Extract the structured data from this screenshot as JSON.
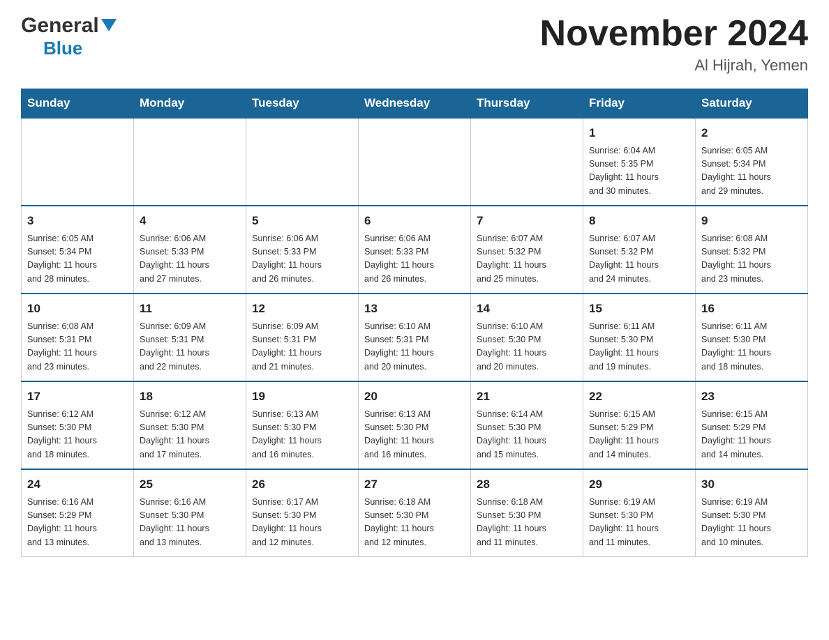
{
  "header": {
    "logo_general": "General",
    "logo_blue": "Blue",
    "month_title": "November 2024",
    "location": "Al Hijrah, Yemen"
  },
  "weekdays": [
    "Sunday",
    "Monday",
    "Tuesday",
    "Wednesday",
    "Thursday",
    "Friday",
    "Saturday"
  ],
  "weeks": [
    [
      {
        "day": "",
        "info": ""
      },
      {
        "day": "",
        "info": ""
      },
      {
        "day": "",
        "info": ""
      },
      {
        "day": "",
        "info": ""
      },
      {
        "day": "",
        "info": ""
      },
      {
        "day": "1",
        "info": "Sunrise: 6:04 AM\nSunset: 5:35 PM\nDaylight: 11 hours\nand 30 minutes."
      },
      {
        "day": "2",
        "info": "Sunrise: 6:05 AM\nSunset: 5:34 PM\nDaylight: 11 hours\nand 29 minutes."
      }
    ],
    [
      {
        "day": "3",
        "info": "Sunrise: 6:05 AM\nSunset: 5:34 PM\nDaylight: 11 hours\nand 28 minutes."
      },
      {
        "day": "4",
        "info": "Sunrise: 6:06 AM\nSunset: 5:33 PM\nDaylight: 11 hours\nand 27 minutes."
      },
      {
        "day": "5",
        "info": "Sunrise: 6:06 AM\nSunset: 5:33 PM\nDaylight: 11 hours\nand 26 minutes."
      },
      {
        "day": "6",
        "info": "Sunrise: 6:06 AM\nSunset: 5:33 PM\nDaylight: 11 hours\nand 26 minutes."
      },
      {
        "day": "7",
        "info": "Sunrise: 6:07 AM\nSunset: 5:32 PM\nDaylight: 11 hours\nand 25 minutes."
      },
      {
        "day": "8",
        "info": "Sunrise: 6:07 AM\nSunset: 5:32 PM\nDaylight: 11 hours\nand 24 minutes."
      },
      {
        "day": "9",
        "info": "Sunrise: 6:08 AM\nSunset: 5:32 PM\nDaylight: 11 hours\nand 23 minutes."
      }
    ],
    [
      {
        "day": "10",
        "info": "Sunrise: 6:08 AM\nSunset: 5:31 PM\nDaylight: 11 hours\nand 23 minutes."
      },
      {
        "day": "11",
        "info": "Sunrise: 6:09 AM\nSunset: 5:31 PM\nDaylight: 11 hours\nand 22 minutes."
      },
      {
        "day": "12",
        "info": "Sunrise: 6:09 AM\nSunset: 5:31 PM\nDaylight: 11 hours\nand 21 minutes."
      },
      {
        "day": "13",
        "info": "Sunrise: 6:10 AM\nSunset: 5:31 PM\nDaylight: 11 hours\nand 20 minutes."
      },
      {
        "day": "14",
        "info": "Sunrise: 6:10 AM\nSunset: 5:30 PM\nDaylight: 11 hours\nand 20 minutes."
      },
      {
        "day": "15",
        "info": "Sunrise: 6:11 AM\nSunset: 5:30 PM\nDaylight: 11 hours\nand 19 minutes."
      },
      {
        "day": "16",
        "info": "Sunrise: 6:11 AM\nSunset: 5:30 PM\nDaylight: 11 hours\nand 18 minutes."
      }
    ],
    [
      {
        "day": "17",
        "info": "Sunrise: 6:12 AM\nSunset: 5:30 PM\nDaylight: 11 hours\nand 18 minutes."
      },
      {
        "day": "18",
        "info": "Sunrise: 6:12 AM\nSunset: 5:30 PM\nDaylight: 11 hours\nand 17 minutes."
      },
      {
        "day": "19",
        "info": "Sunrise: 6:13 AM\nSunset: 5:30 PM\nDaylight: 11 hours\nand 16 minutes."
      },
      {
        "day": "20",
        "info": "Sunrise: 6:13 AM\nSunset: 5:30 PM\nDaylight: 11 hours\nand 16 minutes."
      },
      {
        "day": "21",
        "info": "Sunrise: 6:14 AM\nSunset: 5:30 PM\nDaylight: 11 hours\nand 15 minutes."
      },
      {
        "day": "22",
        "info": "Sunrise: 6:15 AM\nSunset: 5:29 PM\nDaylight: 11 hours\nand 14 minutes."
      },
      {
        "day": "23",
        "info": "Sunrise: 6:15 AM\nSunset: 5:29 PM\nDaylight: 11 hours\nand 14 minutes."
      }
    ],
    [
      {
        "day": "24",
        "info": "Sunrise: 6:16 AM\nSunset: 5:29 PM\nDaylight: 11 hours\nand 13 minutes."
      },
      {
        "day": "25",
        "info": "Sunrise: 6:16 AM\nSunset: 5:30 PM\nDaylight: 11 hours\nand 13 minutes."
      },
      {
        "day": "26",
        "info": "Sunrise: 6:17 AM\nSunset: 5:30 PM\nDaylight: 11 hours\nand 12 minutes."
      },
      {
        "day": "27",
        "info": "Sunrise: 6:18 AM\nSunset: 5:30 PM\nDaylight: 11 hours\nand 12 minutes."
      },
      {
        "day": "28",
        "info": "Sunrise: 6:18 AM\nSunset: 5:30 PM\nDaylight: 11 hours\nand 11 minutes."
      },
      {
        "day": "29",
        "info": "Sunrise: 6:19 AM\nSunset: 5:30 PM\nDaylight: 11 hours\nand 11 minutes."
      },
      {
        "day": "30",
        "info": "Sunrise: 6:19 AM\nSunset: 5:30 PM\nDaylight: 11 hours\nand 10 minutes."
      }
    ]
  ]
}
